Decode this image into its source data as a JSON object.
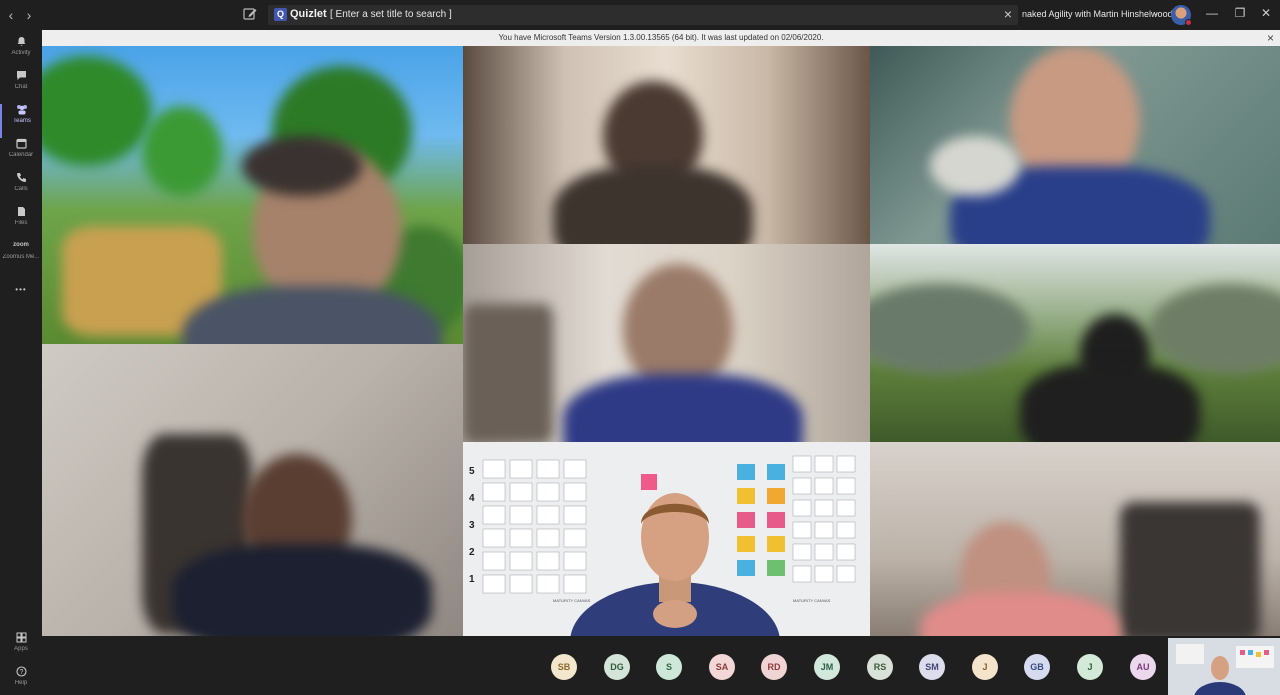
{
  "titlebar": {
    "back_glyph": "‹",
    "forward_glyph": "›",
    "quizlet_logo": "Q",
    "quizlet_name": "Quizlet",
    "search_text": "[ Enter a set title to search ]",
    "search_close": "×",
    "team_name": "naked Agility with Martin Hinshelwood",
    "team_chevron": "⌄",
    "minimize": "—",
    "maximize": "❐",
    "close": "✕"
  },
  "banner": {
    "text": "You have Microsoft Teams Version 1.3.00.13565 (64 bit). It was last updated on 02/06/2020.",
    "close": "×"
  },
  "rail": {
    "items": [
      {
        "label": "Activity",
        "icon": "bell-icon",
        "glyph": "🔔"
      },
      {
        "label": "Chat",
        "icon": "chat-icon",
        "glyph": "▤"
      },
      {
        "label": "Teams",
        "icon": "teams-icon",
        "glyph": "⚇"
      },
      {
        "label": "Calendar",
        "icon": "calendar-icon",
        "glyph": "▦"
      },
      {
        "label": "Calls",
        "icon": "phone-icon",
        "glyph": "✆"
      },
      {
        "label": "Files",
        "icon": "file-icon",
        "glyph": "▯"
      },
      {
        "label": "Zoom",
        "icon": "zoom-icon",
        "glyph": "zoom"
      },
      {
        "label": "Zoomus Me...",
        "icon": "app-icon",
        "glyph": ""
      }
    ],
    "more": "•••",
    "apps_label": "Apps",
    "apps_glyph": "⊞",
    "help_label": "Help",
    "help_glyph": "?"
  },
  "participants": [
    {
      "initials": "SB",
      "bg": "#f2e6cc",
      "fg": "#8a6a2c"
    },
    {
      "initials": "DG",
      "bg": "#d4e4d8",
      "fg": "#2f5a3c"
    },
    {
      "initials": "S",
      "bg": "#cde8d8",
      "fg": "#2d6a46"
    },
    {
      "initials": "SA",
      "bg": "#f3d6d6",
      "fg": "#8a3c3c"
    },
    {
      "initials": "RD",
      "bg": "#f0d4d4",
      "fg": "#8e3a3a"
    },
    {
      "initials": "JM",
      "bg": "#d2e8dc",
      "fg": "#2f6148"
    },
    {
      "initials": "RS",
      "bg": "#d9e2d9",
      "fg": "#3d5a3d"
    },
    {
      "initials": "SM",
      "bg": "#dcdcec",
      "fg": "#45457a"
    },
    {
      "initials": "J",
      "bg": "#f4e4cc",
      "fg": "#86612a"
    },
    {
      "initials": "GB",
      "bg": "#d6dcef",
      "fg": "#3a4a82"
    },
    {
      "initials": "J",
      "bg": "#d4ead8",
      "fg": "#2c6438"
    },
    {
      "initials": "AU",
      "bg": "#ecd8ec",
      "fg": "#7a3e7a"
    }
  ],
  "board": {
    "row_numbers": [
      "5",
      "4",
      "3",
      "2",
      "1"
    ],
    "footer_left": "MATURITY CANVAS",
    "footer_right": "MATURITY CANVAS"
  },
  "colors": {
    "accent": "#7b83eb",
    "presence_busy": "#c4314b"
  }
}
